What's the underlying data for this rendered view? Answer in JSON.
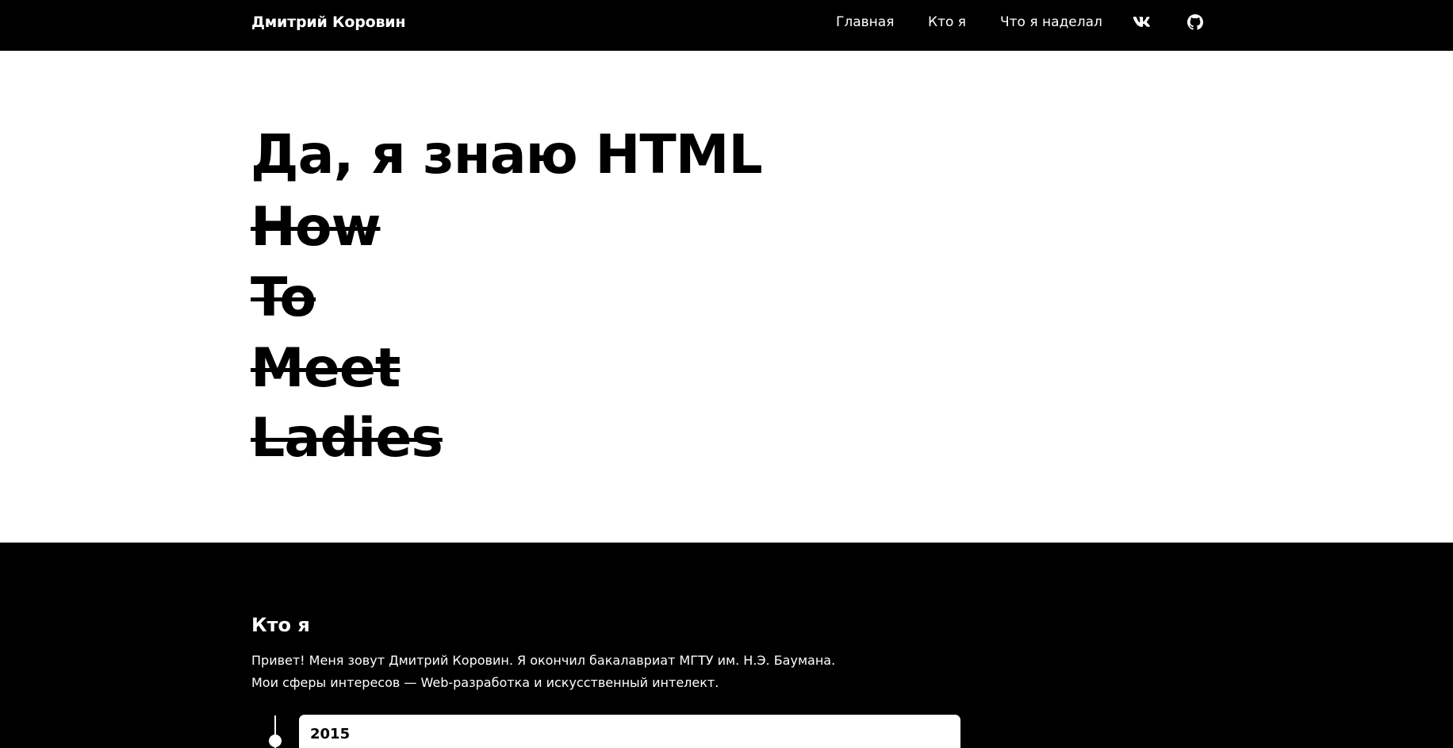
{
  "header": {
    "brand": "Дмитрий Коровин",
    "nav": {
      "home": "Главная",
      "who": "Кто я",
      "work": "Что я наделал"
    },
    "social": [
      "vk-icon",
      "github-icon"
    ]
  },
  "hero": {
    "title": "Да, я знаю HTML",
    "struck_words": [
      "How",
      "To",
      "Meet",
      "Ladies"
    ]
  },
  "about": {
    "heading": "Кто я",
    "line1": "Привет! Меня зовут Дмитрий Коровин. Я окончил бакалавриат МГТУ им. Н.Э. Баумана.",
    "line2": "Мои сферы интересов — Web-разработка и искусственный интелект.",
    "timeline": [
      {
        "year": "2015"
      }
    ]
  },
  "colors": {
    "background": "#ffffff",
    "dark": "#000000",
    "text_light": "#ffffff"
  }
}
